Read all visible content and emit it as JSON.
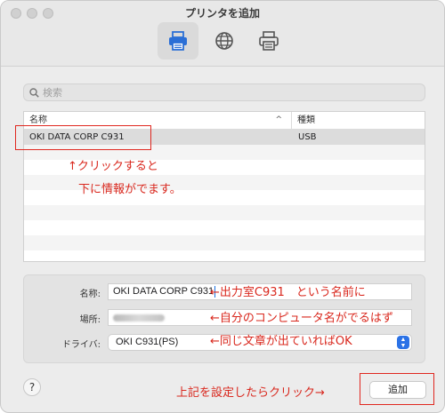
{
  "window": {
    "title": "プリンタを追加"
  },
  "toolbar": {
    "tools": [
      "default-printer-icon",
      "ip-globe-icon",
      "windows-printer-icon"
    ],
    "selected": 0
  },
  "search": {
    "placeholder": "検索",
    "value": ""
  },
  "table": {
    "columns": {
      "name": "名称",
      "kind": "種類"
    },
    "rows": [
      {
        "name": "OKI DATA CORP C931",
        "kind": "USB",
        "selected": true
      }
    ]
  },
  "details": {
    "name_label": "名称:",
    "name_value": "OKI DATA CORP C931",
    "location_label": "場所:",
    "driver_label": "ドライバ:",
    "driver_value": "OKI C931(PS)"
  },
  "buttons": {
    "help": "?",
    "add": "追加"
  },
  "annotations": {
    "a1": "↑クリックすると",
    "a2": "下に情報がでます。",
    "a3": "←出力室C931　という名前に",
    "a4": "←自分のコンピュータ名がでるはず",
    "a5": "←同じ文章が出ていればOK",
    "a6": "上記を設定したらクリック→"
  },
  "colors": {
    "annotation": "#d9281e",
    "accent": "#2b72e6"
  }
}
